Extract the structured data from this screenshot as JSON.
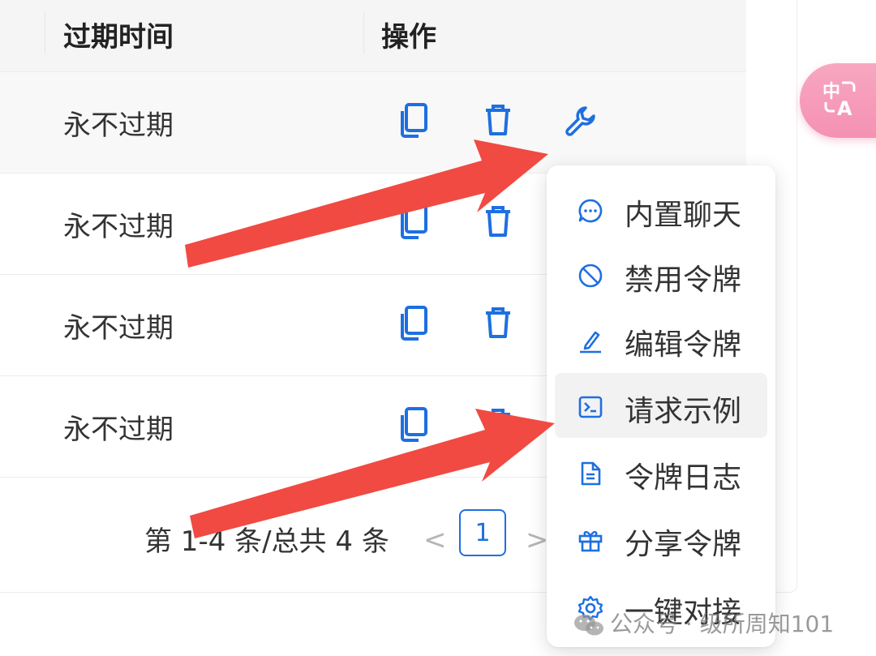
{
  "table": {
    "columns": {
      "expire": "过期时间",
      "actions": "操作"
    },
    "rows": [
      {
        "expire": "永不过期"
      },
      {
        "expire": "永不过期"
      },
      {
        "expire": "永不过期"
      },
      {
        "expire": "永不过期"
      }
    ]
  },
  "pagination": {
    "summary": "第 1-4 条/总共 4 条",
    "prev": "<",
    "current_page": "1",
    "next": ">"
  },
  "float_button": {
    "icon": "translate-icon",
    "color": "#f591b3"
  },
  "dropdown": {
    "items": [
      {
        "label": "内置聊天",
        "icon": "chat-icon"
      },
      {
        "label": "禁用令牌",
        "icon": "ban-icon"
      },
      {
        "label": "编辑令牌",
        "icon": "edit-icon"
      },
      {
        "label": "请求示例",
        "icon": "terminal-icon"
      },
      {
        "label": "令牌日志",
        "icon": "file-icon"
      },
      {
        "label": "分享令牌",
        "icon": "gift-icon"
      },
      {
        "label": "一键对接",
        "icon": "settings-icon"
      }
    ],
    "highlighted": "请求示例"
  },
  "annotation_arrow_color": "#f04a42",
  "accent_color": "#1e6fe0",
  "watermark": "公众号 · 级所周知101"
}
